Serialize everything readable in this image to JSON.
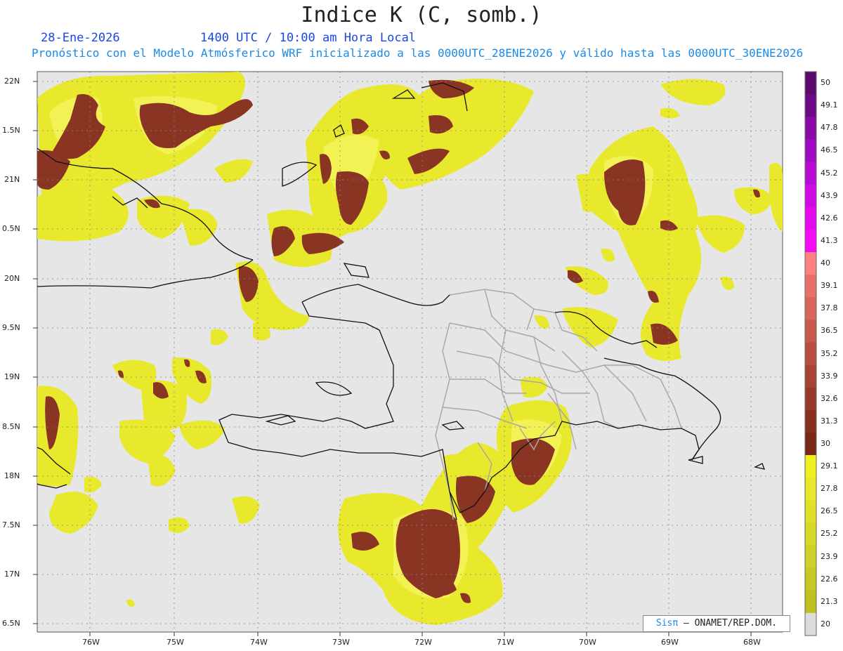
{
  "header": {
    "title": "Indice K (C, somb.)",
    "date": "28-Ene-2026",
    "time": "1400 UTC / 10:00 am Hora Local",
    "subtitle": "Pronóstico con el Modelo Atmósferico WRF inicializado a las 0000UTC_28ENE2026 y válido hasta las  0000UTC_30ENE2026"
  },
  "axes": {
    "lat_labels": [
      "22N",
      "1.5N",
      "21N",
      "0.5N",
      "20N",
      "9.5N",
      "19N",
      "8.5N",
      "18N",
      "7.5N",
      "17N",
      "6.5N"
    ],
    "lon_labels": [
      "76W",
      "75W",
      "74W",
      "73W",
      "72W",
      "71W",
      "70W",
      "69W",
      "68W"
    ]
  },
  "colorbar": {
    "labels": [
      "50",
      "49.1",
      "47.8",
      "46.5",
      "45.2",
      "43.9",
      "42.6",
      "41.3",
      "40",
      "39.1",
      "37.8",
      "36.5",
      "35.2",
      "33.9",
      "32.6",
      "31.3",
      "30",
      "29.1",
      "27.8",
      "26.5",
      "25.2",
      "23.9",
      "22.6",
      "21.3",
      "20"
    ],
    "colors": [
      "#5c0a6e",
      "#6e0a86",
      "#8a0aa6",
      "#a00ac0",
      "#b80ad4",
      "#cf0ae6",
      "#e30af0",
      "#f50af5",
      "#ff8080",
      "#e87068",
      "#d9665a",
      "#c85a4c",
      "#b84e40",
      "#a84434",
      "#983a2a",
      "#883020",
      "#7a2818",
      "#f0f020",
      "#e8e828",
      "#e0e028",
      "#d8d828",
      "#d0d028",
      "#c8c824",
      "#c0c020",
      "#dcdcdc"
    ]
  },
  "credit": {
    "brand": "Sisπ",
    "text": "– ONAMET/REP.DOM."
  },
  "colors": {
    "background": "#e6e6e6",
    "yellow": "#e8e82c",
    "yellow_light": "#f4f450",
    "brown": "#8a3424"
  }
}
